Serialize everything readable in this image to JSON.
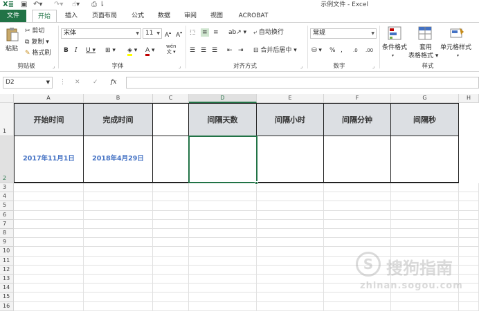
{
  "window": {
    "title": "示例文件 - Excel"
  },
  "quick_access": [
    "excel-logo-icon",
    "save-icon",
    "undo-icon",
    "redo-icon",
    "touch-mode-icon",
    "print-preview-icon"
  ],
  "tabs": [
    {
      "label": "文件",
      "kind": "file"
    },
    {
      "label": "开始",
      "kind": "active"
    },
    {
      "label": "插入",
      "kind": ""
    },
    {
      "label": "页面布局",
      "kind": ""
    },
    {
      "label": "公式",
      "kind": ""
    },
    {
      "label": "数据",
      "kind": ""
    },
    {
      "label": "审阅",
      "kind": ""
    },
    {
      "label": "视图",
      "kind": ""
    },
    {
      "label": "ACROBAT",
      "kind": ""
    }
  ],
  "ribbon": {
    "clipboard": {
      "label": "剪贴板",
      "paste": "粘贴",
      "cut": "剪切",
      "copy": "复制",
      "format_painter": "格式刷"
    },
    "font": {
      "label": "字体",
      "name": "宋体",
      "size": "11",
      "wen": "wén"
    },
    "alignment": {
      "label": "对齐方式",
      "wrap": "自动换行",
      "merge": "合并后居中"
    },
    "number": {
      "label": "数字",
      "format": "常规"
    },
    "styles": {
      "label": "样式",
      "conditional": "条件格式",
      "table_format_1": "套用",
      "table_format_2": "表格格式",
      "cell_styles": "单元格样式"
    }
  },
  "formula_bar": {
    "name_box": "D2",
    "value": ""
  },
  "sheet": {
    "columns": [
      "A",
      "B",
      "C",
      "D",
      "E",
      "F",
      "G",
      "H"
    ],
    "selected_column": "D",
    "rows": [
      "1",
      "2",
      "3",
      "4",
      "5",
      "6",
      "7",
      "8",
      "9",
      "10",
      "11",
      "12",
      "13",
      "14",
      "15",
      "16"
    ],
    "selected_row": "2",
    "header_row": [
      "开始时间",
      "完成时间",
      "",
      "间隔天数",
      "间隔小时",
      "间隔分钟",
      "间隔秒"
    ],
    "data_row": [
      "2017年11月1日",
      "2018年4月29日",
      "",
      "",
      "",
      "",
      ""
    ]
  },
  "watermark": {
    "brand": "搜狗指南",
    "url": "zhinan.sogou.com"
  }
}
